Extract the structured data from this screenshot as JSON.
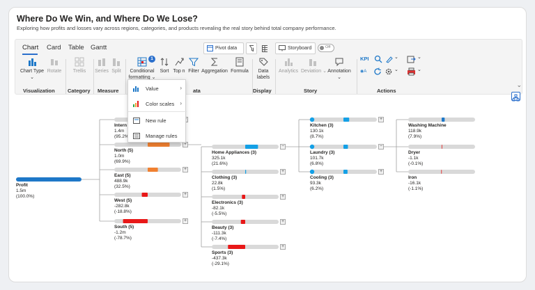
{
  "header": {
    "title": "Where Do We Win, and Where Do We Lose?",
    "subtitle": "Exploring how profits and losses vary across regions, categories, and products revealing the real story behind total company performance."
  },
  "tabs": [
    "Chart",
    "Card",
    "Table",
    "Gantt"
  ],
  "ribbon_top": {
    "pivot_label": "Pivot data",
    "storyboard_label": "Storyboard",
    "toggle_label": "Off"
  },
  "ribbon": {
    "chart_type": "Chart Type",
    "rotate": "Rotate",
    "trellis": "Trellis",
    "series": "Series",
    "split": "Split",
    "conditional_1": "Conditional",
    "conditional_2": "formatting",
    "conditional_badge": "1",
    "sort": "Sort",
    "topn": "Top n",
    "filter": "Filter",
    "aggregation": "Aggregation",
    "formula": "Formula",
    "data_labels_1": "Data",
    "data_labels_2": "labels",
    "analytics": "Analytics",
    "deviation": "Deviation",
    "annotation": "Annotation",
    "kpi": "KPI"
  },
  "groups": {
    "visualization": "Visualization",
    "category": "Category",
    "measure": "Measure",
    "data": "ata",
    "display": "Display",
    "story": "Story",
    "actions": "Actions"
  },
  "menu": {
    "value": "Value",
    "color_scales": "Color scales",
    "new_rule": "New rule",
    "manage_rules": "Manage rules"
  },
  "colors": {
    "positive_bar": "#1e78c8",
    "positive_light": "#14a0e6",
    "negative": "#e81818",
    "orange": "#f08030",
    "track": "#d9d9d9",
    "accent": "#2a6fcc"
  },
  "tree": {
    "root": {
      "name": "Profit",
      "value": "1.5m",
      "pct": "(100.0%)",
      "share": 1.0
    },
    "regions": [
      {
        "name": "Intern",
        "value": "1.4m",
        "pct": "(95.2%",
        "share": 0.952
      },
      {
        "name": "North (5)",
        "value": "1.0m",
        "pct": "(69.9%)",
        "share": 0.699
      },
      {
        "name": "East (5)",
        "value": "488.9k",
        "pct": "(32.5%)",
        "share": 0.325
      },
      {
        "name": "West (5)",
        "value": "-282.8k",
        "pct": "(-18.8%)",
        "share": -0.188
      },
      {
        "name": "South (5)",
        "value": "-1.2m",
        "pct": "(-78.7%)",
        "share": -0.787
      }
    ],
    "categories": [
      {
        "name": "Home Appliances (3)",
        "value": "325.1k",
        "pct": "(21.6%)",
        "share": 0.216
      },
      {
        "name": "Clothing (3)",
        "value": "22.8k",
        "pct": "(1.5%)",
        "share": 0.015
      },
      {
        "name": "Electronics (3)",
        "value": "-82.1k",
        "pct": "(-5.5%)",
        "share": -0.055
      },
      {
        "name": "Beauty (3)",
        "value": "-111.3k",
        "pct": "(-7.4%)",
        "share": -0.074
      },
      {
        "name": "Sports (3)",
        "value": "-437.3k",
        "pct": "(-29.1%)",
        "share": -0.291
      }
    ],
    "subcategories": [
      {
        "name": "Kitchen (3)",
        "value": "130.1k",
        "pct": "(8.7%)",
        "share": 0.087
      },
      {
        "name": "Laundry (3)",
        "value": "101.7k",
        "pct": "(6.8%)",
        "share": 0.068
      },
      {
        "name": "Cooling (3)",
        "value": "93.3k",
        "pct": "(6.2%)",
        "share": 0.062
      }
    ],
    "products": [
      {
        "name": "Washing Machine",
        "value": "118.9k",
        "pct": "(7.9%)",
        "share": 0.079
      },
      {
        "name": "Dryer",
        "value": "-1.1k",
        "pct": "(-0.1%)",
        "share": -0.001
      },
      {
        "name": "Iron",
        "value": "-16.1k",
        "pct": "(-1.1%)",
        "share": -0.011
      }
    ]
  }
}
